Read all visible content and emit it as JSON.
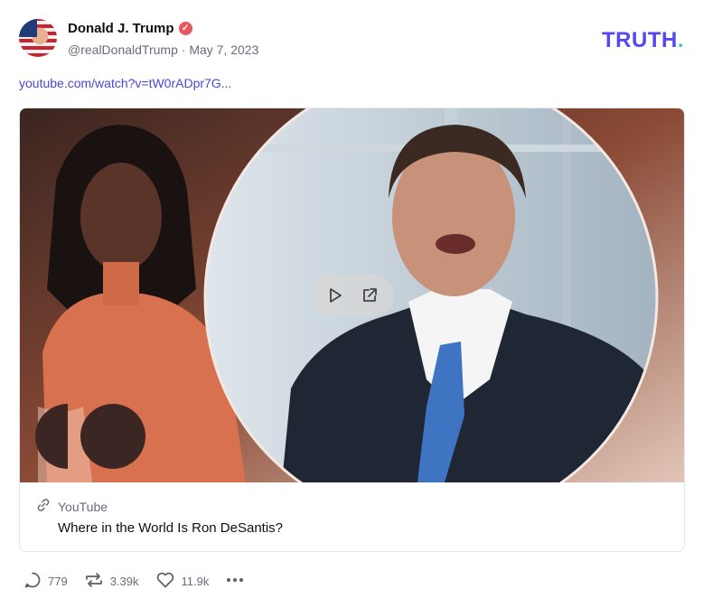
{
  "post": {
    "author_name": "Donald J. Trump",
    "verified_badge": "✓",
    "handle": "@realDonaldTrump",
    "separator": "·",
    "date": "May 7, 2023",
    "link_text": "youtube.com/watch?v=tW0rADpr7G..."
  },
  "brand": {
    "logo_text": "TRUTH",
    "logo_dot": ".",
    "logo_color": "#5448ee",
    "dot_color": "#3fd19a"
  },
  "card": {
    "source": "YouTube",
    "title": "Where in the World Is Ron DeSantis?",
    "icons": [
      "link-icon",
      "play-icon",
      "open-external-icon"
    ]
  },
  "actions": {
    "replies": "779",
    "reposts": "3.39k",
    "likes": "11.9k",
    "icons": [
      "reply-icon",
      "repost-icon",
      "heart-icon",
      "more-icon"
    ]
  }
}
